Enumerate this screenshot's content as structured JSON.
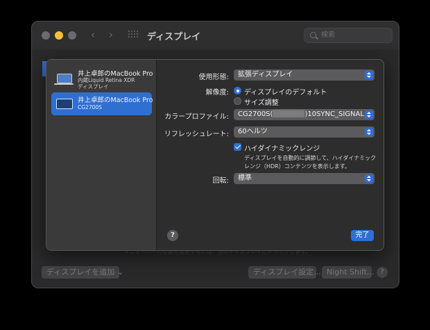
{
  "window": {
    "title": "ディスプレイ",
    "search_placeholder": "検索",
    "nav_back": "‹",
    "nav_forward": "›"
  },
  "background": {
    "hint_text": "メニューバーの位置を変更するには、別のディスプレイにドラッグします。",
    "add_display_label": "ディスプレイを追加 ⌄",
    "display_settings_label": "ディスプレイ設定...",
    "night_shift_label": "Night Shift...",
    "help_label": "?"
  },
  "sheet": {
    "displays": [
      {
        "name": "井上卓郎のMacBook Pro",
        "sub1": "内蔵Liquid Retina XDR",
        "sub2": "ディスプレイ",
        "selected": false
      },
      {
        "name": "井上卓郎のMacBook Pro",
        "sub1": "CG2700S",
        "selected": true
      }
    ],
    "usage_label": "使用形態:",
    "usage_value": "拡張ディスプレイ",
    "resolution_label": "解像度:",
    "resolution_options": [
      {
        "label": "ディスプレイのデフォルト",
        "selected": true
      },
      {
        "label": "サイズ調整",
        "selected": false
      }
    ],
    "color_profile_label": "カラープロファイル:",
    "color_profile_prefix": "CG2700S(",
    "color_profile_suffix": ")10SYNC_SIGNAL",
    "refresh_label": "リフレッシュレート:",
    "refresh_value": "60ヘルツ",
    "hdr_label": "ハイダイナミックレンジ",
    "hdr_checked": true,
    "hdr_description": "ディスプレイを自動的に調節して、ハイダイナミックレンジ（HDR）コンテンツを表示します。",
    "rotation_label": "回転:",
    "rotation_value": "標準",
    "help_label": "?",
    "done_label": "完了"
  },
  "colors": {
    "accent": "#2f6fd2",
    "window_bg": "#2a2a2b",
    "sheet_bg": "#2d2d2e",
    "sidebar_bg": "#3a3a3a"
  }
}
